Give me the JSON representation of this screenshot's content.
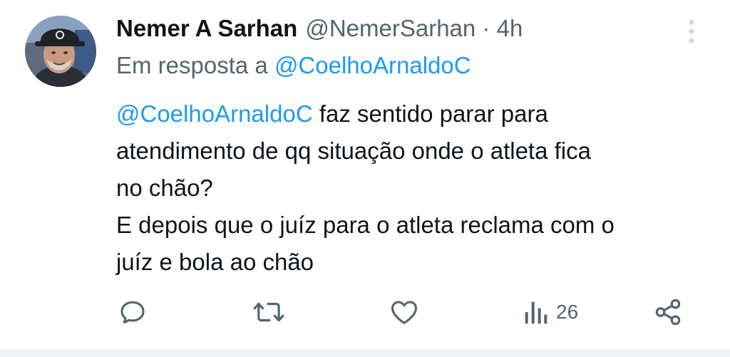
{
  "tweet": {
    "author_name": "Nemer A Sarhan",
    "handle": "@NemerSarhan",
    "separator": "·",
    "time": "4h",
    "reply_prefix": "Em resposta a",
    "reply_to": "@CoelhoArnaldoC",
    "body_mention": "@CoelhoArnaldoC",
    "body_lines": [
      " faz sentido parar para",
      "atendimento de qq situação onde o atleta fica",
      "no chão?",
      "E depois que o juíz para o atleta reclama com o",
      "juíz e bola ao chão"
    ],
    "views": "26"
  },
  "icons": {
    "more": "more-vertical-icon",
    "reply": "reply-icon",
    "retweet": "retweet-icon",
    "like": "heart-icon",
    "views": "views-chart-icon",
    "share": "share-icon"
  },
  "colors": {
    "text": "#0f1419",
    "secondary": "#536471",
    "link": "#1d9bf0",
    "more_icon": "#cfd9de"
  }
}
